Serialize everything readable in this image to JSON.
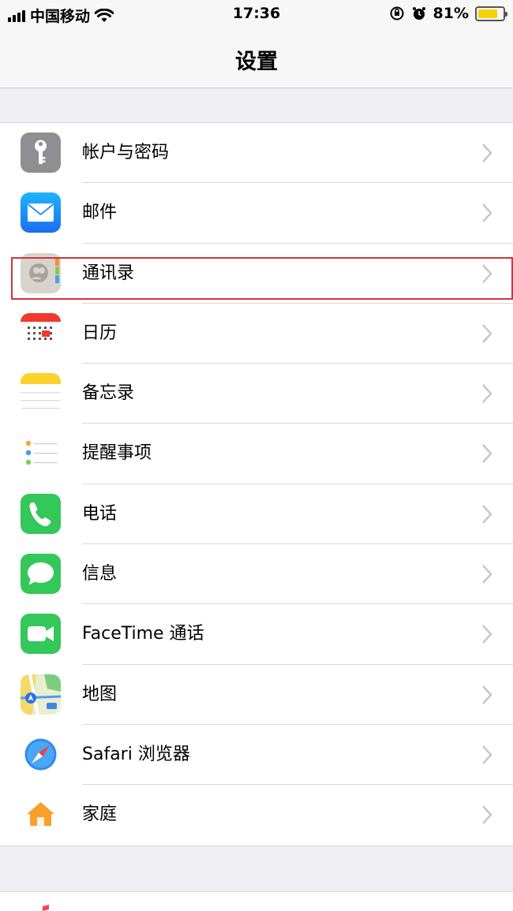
{
  "status_bar": {
    "carrier": "中国移动",
    "time": "17:36",
    "battery": "81%",
    "battery_level": 0.81,
    "icons": [
      "signal-icon",
      "wifi-icon",
      "rotation-lock-icon",
      "alarm-icon",
      "battery-icon"
    ]
  },
  "nav": {
    "title": "设置"
  },
  "settings": {
    "items": [
      {
        "label": "帐户与密码",
        "icon": "key-icon"
      },
      {
        "label": "邮件",
        "icon": "mail-icon"
      },
      {
        "label": "通讯录",
        "icon": "contacts-icon",
        "highlighted": true
      },
      {
        "label": "日历",
        "icon": "calendar-icon"
      },
      {
        "label": "备忘录",
        "icon": "notes-icon"
      },
      {
        "label": "提醒事项",
        "icon": "reminders-icon"
      },
      {
        "label": "电话",
        "icon": "phone-icon"
      },
      {
        "label": "信息",
        "icon": "messages-icon"
      },
      {
        "label": "FaceTime 通话",
        "icon": "facetime-icon"
      },
      {
        "label": "地图",
        "icon": "maps-icon"
      },
      {
        "label": "Safari 浏览器",
        "icon": "safari-icon"
      },
      {
        "label": "家庭",
        "icon": "home-icon"
      }
    ],
    "next_icon": "music-icon"
  },
  "colors": {
    "highlight": "#c9383a",
    "battery": "#f5d10e",
    "mail": "#1e8df5",
    "phone": "#34c759",
    "calendar_red": "#f03a2e",
    "notes_yellow": "#fcd32d"
  }
}
